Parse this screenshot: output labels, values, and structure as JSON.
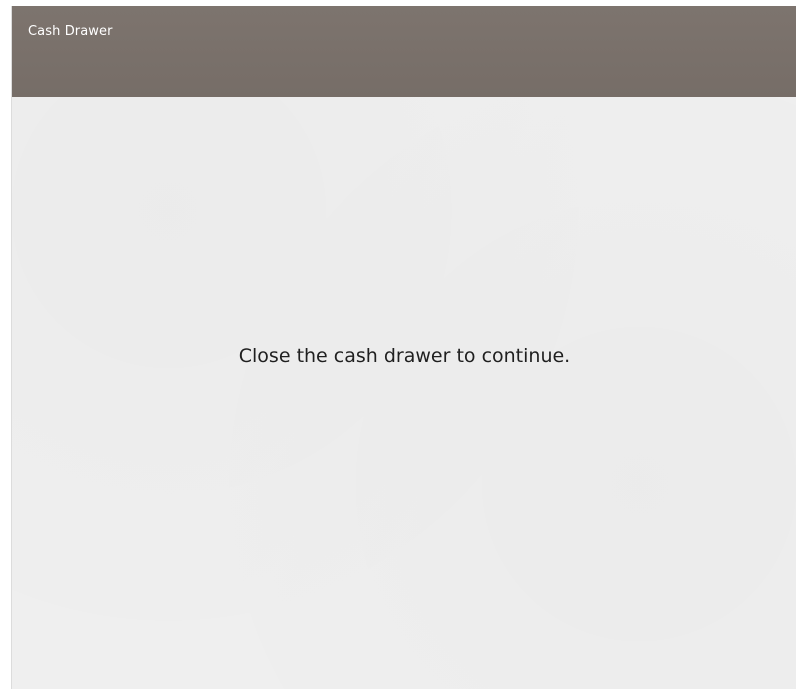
{
  "window": {
    "title": "Cash Drawer"
  },
  "dialog": {
    "message": "Close the cash drawer to continue."
  },
  "colors": {
    "titlebar": "#7a716b",
    "background": "#efefef",
    "title_text": "#ffffff",
    "message_text": "#1f1f1f"
  }
}
